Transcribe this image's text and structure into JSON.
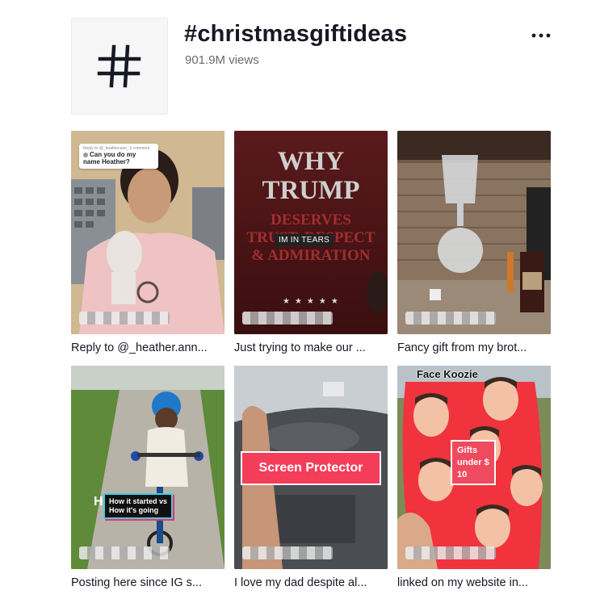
{
  "header": {
    "tag_symbol": "#",
    "title": "#christmasgiftideas",
    "views": "901.9M views",
    "more_label": "···"
  },
  "videos": [
    {
      "caption": "Reply to @_heather.ann...",
      "overlay": {
        "comment_header": "Reply to @_heather.ann_'s comment",
        "comment_text": "Can you do my name Heather?"
      }
    },
    {
      "caption": "Just trying to make our ...",
      "overlay": {
        "book_title_1": "WHY",
        "book_title_2": "TRUMP",
        "book_sub_1": "DESERVES",
        "book_sub_2": "TRUST, RESPECT",
        "book_sub_3": "& ADMIRATION",
        "label": "IM IN TEARS",
        "stars": "★★★★★"
      }
    },
    {
      "caption": "Fancy gift from my brot...",
      "overlay": {}
    },
    {
      "caption": "Posting here since IG s...",
      "overlay": {
        "letter": "H",
        "line1": "How it started vs",
        "line2": "How it's going"
      }
    },
    {
      "caption": "I love my dad despite al...",
      "overlay": {
        "label": "Screen Protector"
      }
    },
    {
      "caption": "linked on my website in...",
      "overlay": {
        "top_label": "Face Koozie",
        "gifts_1": "Gifts",
        "gifts_2": "under $",
        "gifts_3": "10"
      }
    }
  ],
  "colors": {
    "accent_pink": "#f33d59",
    "text_primary": "#161823",
    "text_secondary": "#6a6b70"
  }
}
